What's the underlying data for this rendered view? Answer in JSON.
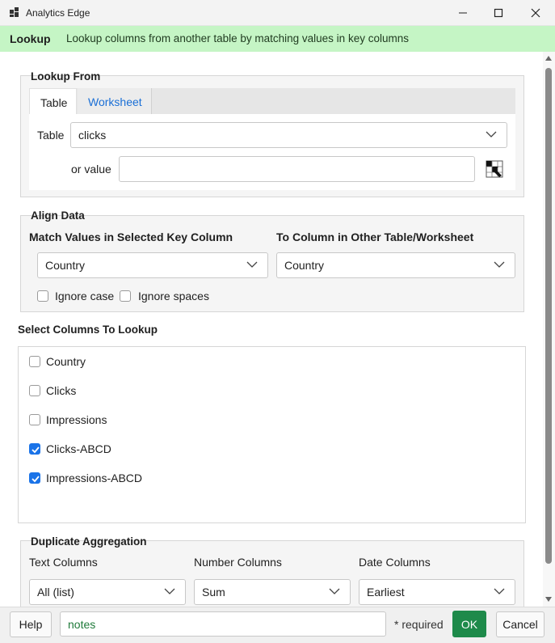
{
  "window": {
    "title": "Analytics Edge"
  },
  "banner": {
    "title": "Lookup",
    "description": "Lookup columns from another table by matching values in key columns"
  },
  "lookup_from": {
    "title": "Lookup From",
    "tabs": [
      {
        "label": "Table",
        "selected": true
      },
      {
        "label": "Worksheet",
        "selected": false
      }
    ],
    "table_label": "Table",
    "table_value": "clicks",
    "or_value_label": "or value",
    "or_value": ""
  },
  "align_data": {
    "title": "Align Data",
    "match_label": "Match Values in Selected Key Column",
    "to_label": "To Column in Other Table/Worksheet",
    "match_value": "Country",
    "to_value": "Country",
    "ignore_case_label": "Ignore case",
    "ignore_spaces_label": "Ignore spaces",
    "ignore_case": false,
    "ignore_spaces": false
  },
  "select_columns": {
    "title": "Select Columns To Lookup",
    "items": [
      {
        "label": "Country",
        "checked": false
      },
      {
        "label": "Clicks",
        "checked": false
      },
      {
        "label": "Impressions",
        "checked": false
      },
      {
        "label": "Clicks-ABCD",
        "checked": true
      },
      {
        "label": "Impressions-ABCD",
        "checked": true
      }
    ]
  },
  "duplicate_aggregation": {
    "title": "Duplicate Aggregation",
    "text_label": "Text Columns",
    "number_label": "Number Columns",
    "date_label": "Date Columns",
    "text_value": "All (list)",
    "number_value": "Sum",
    "date_value": "Earliest"
  },
  "footer": {
    "help_label": "Help",
    "notes_value": "notes",
    "required_label": "* required",
    "ok_label": "OK",
    "cancel_label": "Cancel"
  },
  "colors": {
    "banner": "#c5f5c5",
    "ok_button": "#1e8a4a",
    "accent": "#1a73e8"
  },
  "icons": {
    "app": "app-icon",
    "cell_picker": "cell-picker-icon"
  }
}
